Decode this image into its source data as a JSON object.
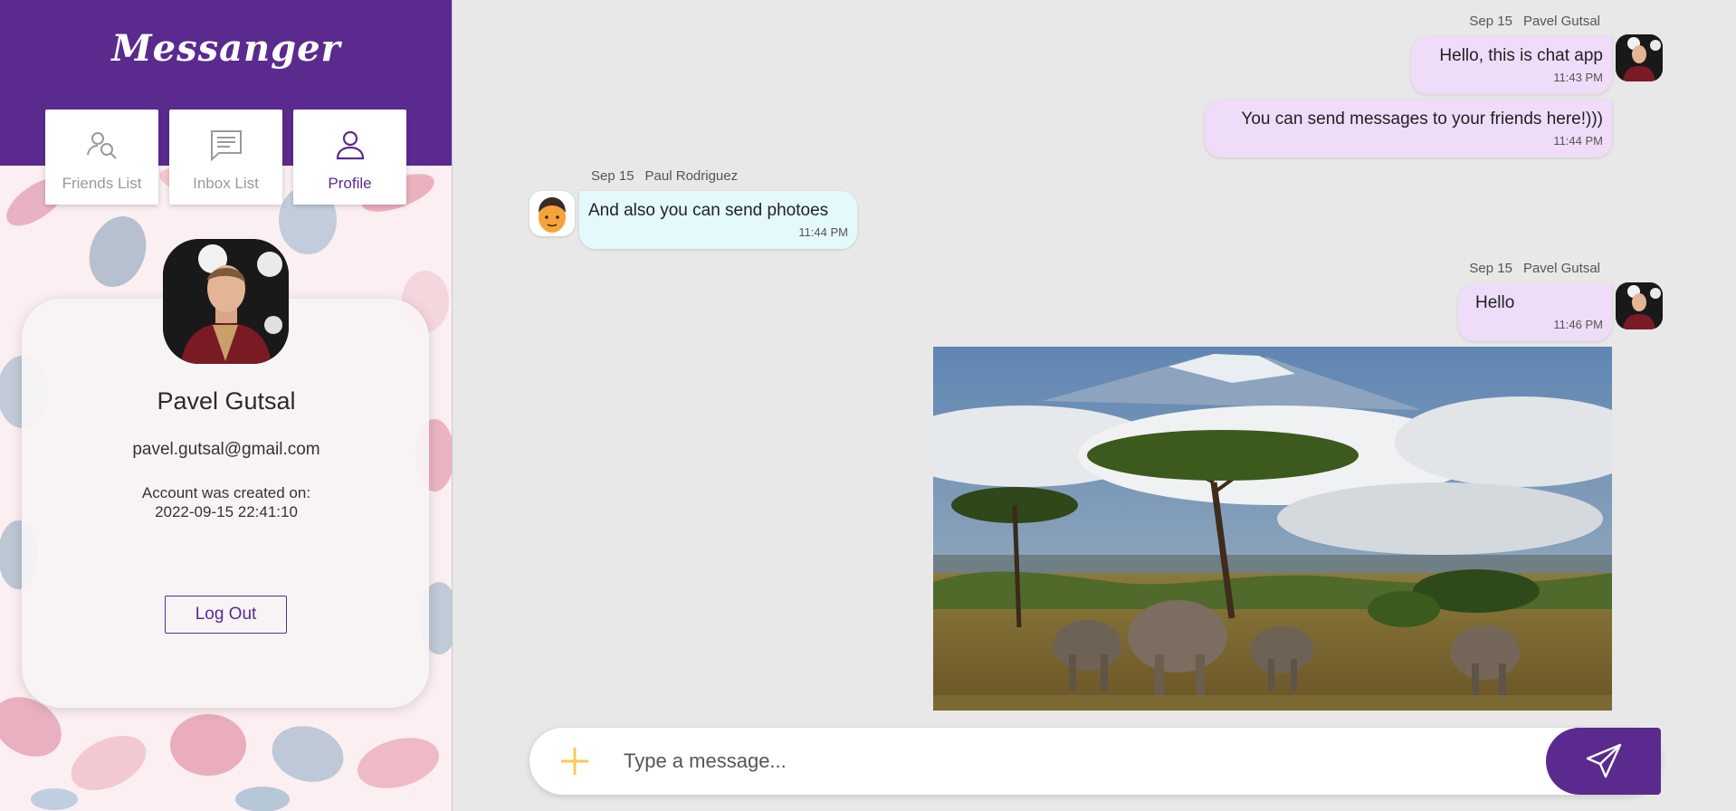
{
  "app": {
    "title": "Messanger"
  },
  "tabs": [
    {
      "label": "Friends List",
      "icon": "friends-search-icon",
      "active": false
    },
    {
      "label": "Inbox List",
      "icon": "message-icon",
      "active": false
    },
    {
      "label": "Profile",
      "icon": "user-icon",
      "active": true
    }
  ],
  "profile": {
    "name": "Pavel Gutsal",
    "email": "pavel.gutsal@gmail.com",
    "created_label": "Account was created on:",
    "created_value": "2022-09-15 22:41:10",
    "logout_label": "Log Out"
  },
  "messages": [
    {
      "date": "Sep 15",
      "sender": "Pavel Gutsal",
      "text": "Hello, this is chat app",
      "time": "11:43 PM",
      "own": true
    },
    {
      "text": "You can send messages to your friends here!)))",
      "time": "11:44 PM",
      "own": true
    },
    {
      "date": "Sep 15",
      "sender": "Paul Rodriguez",
      "text": "And also you can send photoes",
      "time": "11:44 PM",
      "own": false
    },
    {
      "date": "Sep 15",
      "sender": "Pavel Gutsal",
      "text": "Hello",
      "time": "11:46 PM",
      "own": true,
      "has_photo": true
    }
  ],
  "composer": {
    "placeholder": "Type a message..."
  },
  "colors": {
    "primary": "#5b2a8e",
    "own_bubble": "#efdcf8",
    "their_bubble": "#e3f9fb",
    "plus": "#f5cc55"
  }
}
